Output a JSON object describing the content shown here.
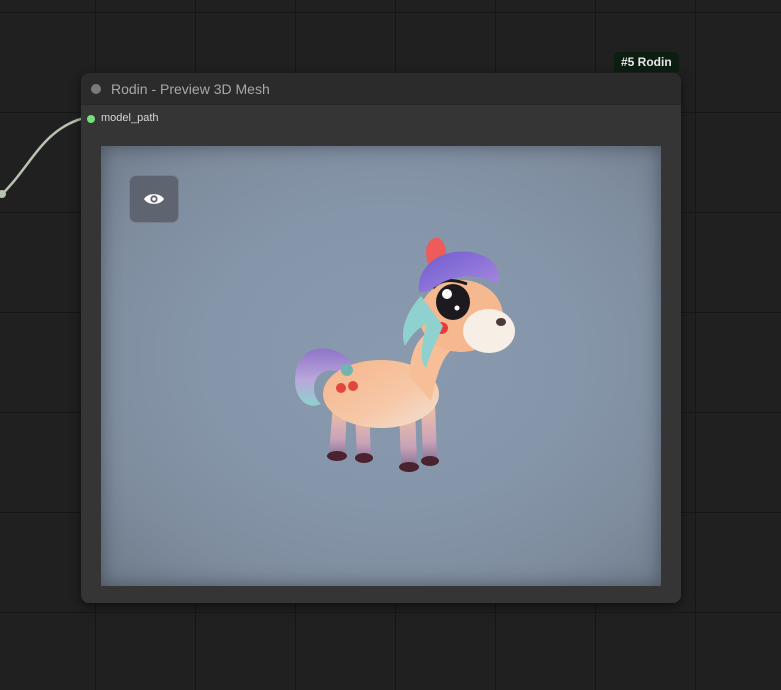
{
  "node": {
    "badge": "#5 Rodin",
    "title": "Rodin - Preview 3D Mesh",
    "input_label": "model_path"
  },
  "viewer": {
    "toggle_icon": "eye-icon",
    "model_subject": "cartoon pony"
  },
  "colors": {
    "input_slot": "#78e07a",
    "canvas_bg": "#202020",
    "node_bg": "#353535",
    "viewport_bg": "#8696aa"
  }
}
